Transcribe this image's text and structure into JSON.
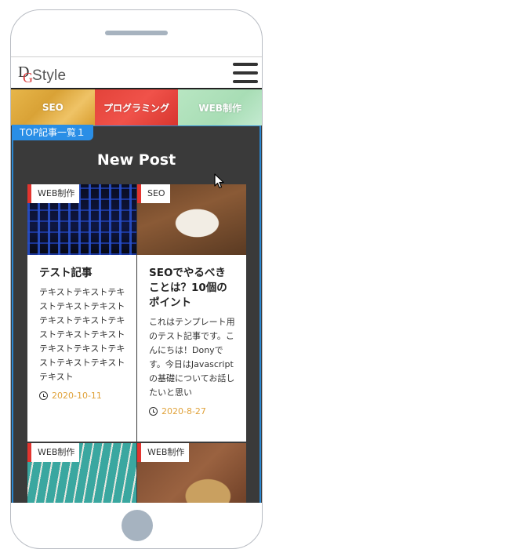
{
  "header": {
    "logo_text": "Style",
    "logo_mark_d": "D",
    "logo_mark_g": "G"
  },
  "nav": {
    "categories": [
      {
        "label": "SEO"
      },
      {
        "label": "プログラミング"
      },
      {
        "label": "WEB制作"
      }
    ]
  },
  "section": {
    "tag": "TOP記事一覧１",
    "title": "New Post"
  },
  "posts": [
    {
      "category": "WEB制作",
      "title": "テスト記事",
      "excerpt": "テキストテキストテキストテキストテキストテキストテキストテキストテキストテキストテキストテキストテキストテキストテキストテキスト",
      "date": "2020-10-11"
    },
    {
      "category": "SEO",
      "title": "SEOでやるべきことは？10個のポイント",
      "excerpt": "これはテンプレート用のテスト記事です。こんにちは！Donyです。今日はJavascriptの基礎についてお話したいと思い",
      "date": "2020-8-27"
    },
    {
      "category": "WEB制作"
    },
    {
      "category": "WEB制作"
    }
  ],
  "colors": {
    "accent_blue": "#2a8ee6",
    "badge_red": "#e2342f",
    "date_orange": "#e0a23a",
    "content_bg": "#3a3a3a"
  }
}
